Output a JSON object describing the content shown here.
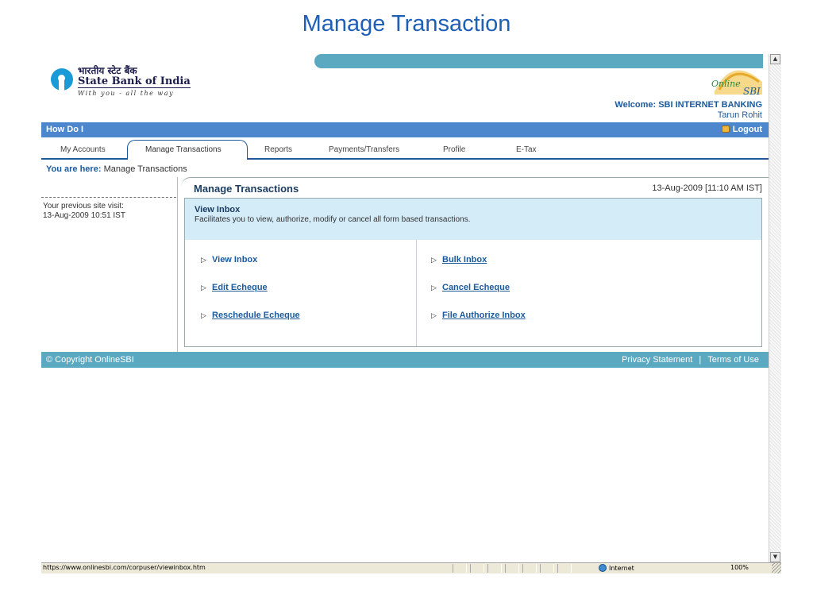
{
  "slide_title": "Manage Transaction",
  "header": {
    "logo_hindi": "भारतीय स्टेट बैंक",
    "logo_name": "State Bank of India",
    "logo_tagline": "With you - all the way",
    "badge_text_1": "Online",
    "badge_text_2": "SBI",
    "welcome": "Welcome: SBI INTERNET BANKING",
    "user_name": "Tarun Rohit"
  },
  "bar": {
    "how_do_i": "How Do I",
    "logout": "Logout"
  },
  "tabs": [
    {
      "label": "My Accounts"
    },
    {
      "label": "Manage Transactions",
      "active": true
    },
    {
      "label": "Reports"
    },
    {
      "label": "Payments/Transfers"
    },
    {
      "label": "Profile"
    },
    {
      "label": "E-Tax"
    }
  ],
  "breadcrumb": {
    "prefix": "You are here:",
    "current": "Manage Transactions"
  },
  "left": {
    "previous_label": "Your previous site visit:",
    "previous_value": "13-Aug-2009 10:51 IST"
  },
  "panel": {
    "title": "Manage Transactions",
    "date": "13-Aug-2009 [11:10 AM IST]",
    "info_heading": "View Inbox",
    "info_desc": "Facilitates you to view, authorize, modify or cancel all form based transactions.",
    "links": {
      "view_inbox": "View Inbox",
      "bulk_inbox": "Bulk Inbox",
      "edit_echeque": "Edit Echeque",
      "cancel_echeque": "Cancel Echeque",
      "reschedule_echeque": "Reschedule Echeque",
      "file_authorize_inbox": "File Authorize Inbox"
    }
  },
  "footer": {
    "copyright": "© Copyright OnlineSBI",
    "privacy": "Privacy Statement",
    "separator": "|",
    "terms": "Terms of Use"
  },
  "statusbar": {
    "url": "https://www.onlinesbi.com/corpuser/viewinbox.htm",
    "zone": "Internet",
    "zoom": "100%"
  },
  "colors": {
    "accent_blue": "#4c86cc",
    "teal": "#5ba8c1",
    "title_blue": "#1f5fb8",
    "info_bg": "#d4ebf8"
  }
}
